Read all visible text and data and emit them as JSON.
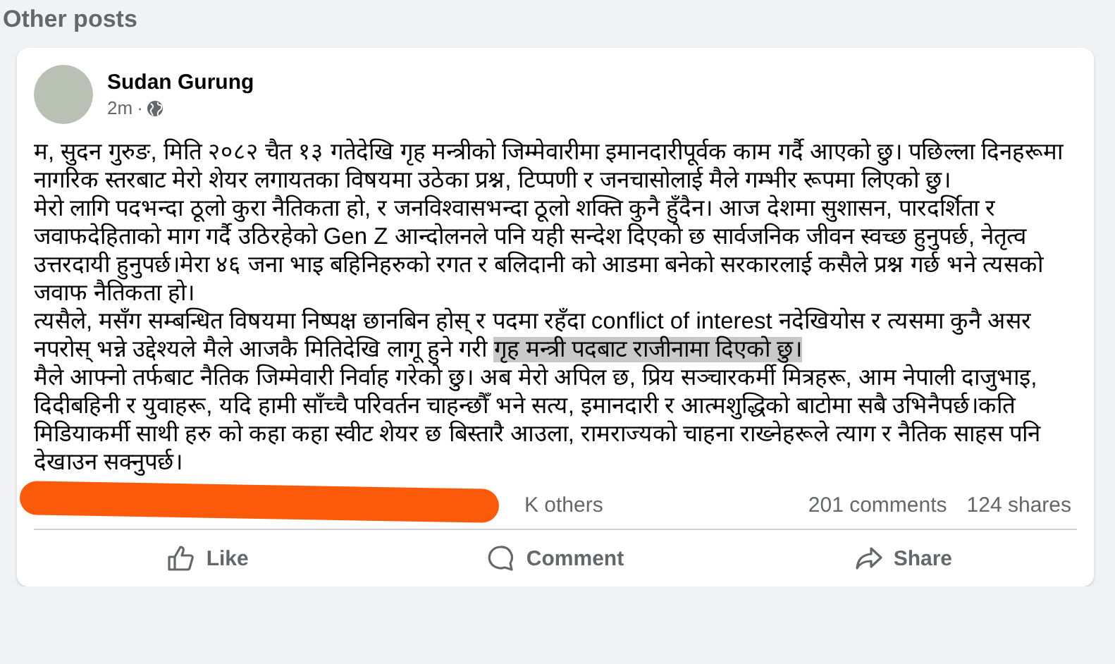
{
  "section_title": "Other posts",
  "post": {
    "author": "Sudan Gurung",
    "time": "2m",
    "separator": "·",
    "paragraphs": [
      {
        "text": "म, सुदन गुरुङ, मिति २०८२ चैत १३ गतेदेखि गृह मन्त्रीको जिम्मेवारीमा इमानदारीपूर्वक काम गर्दै आएको छु। पछिल्ला दिनहरूमा नागरिक स्तरबाट मेरो शेयर लगायतका विषयमा उठेका प्रश्न, टिप्पणी र जनचासोलाई मैले गम्भीर रूपमा लिएको छु।"
      },
      {
        "text": "मेरो लागि पदभन्दा ठूलो कुरा नैतिकता हो, र जनविश्वासभन्दा ठूलो शक्ति कुनै हुँदैन। आज देशमा सुशासन, पारदर्शिता र जवाफदेहिताको माग गर्दै उठिरहेको Gen Z  आन्दोलनले पनि यही सन्देश दिएको छ सार्वजनिक जीवन स्वच्छ हुनुपर्छ, नेतृत्व उत्तरदायी हुनुपर्छ।मेरा ४६ जना भाइ बहिनिहरुको रगत र बलिदानी को आडमा बनेको सरकारलाई कसैले प्रश्न गर्छ भने त्यसको जवाफ नैतिकता हो।"
      },
      {
        "text": "त्यसैले, मसँग सम्बन्धित विषयमा निष्पक्ष छानबिन होस् र पदमा रहँदा conflict of interest नदेखियोस र  त्यसमा कुनै असर नपरोस् भन्ने उद्देश्यले मैले आजकै मितिदेखि लागू हुने गरी ",
        "highlight": "गृह मन्त्री पदबाट राजीनामा दिएको छु।"
      },
      {
        "text": "मैले आफ्नो तर्फबाट नैतिक जिम्मेवारी निर्वाह गरेको छु। अब मेरो अपिल छ, प्रिय सञ्चारकर्मी मित्रहरू, आम नेपाली दाजुभाइ, दिदीबहिनी र युवाहरू, यदि हामी साँच्चै परिवर्तन चाहन्छौँ भने सत्य, इमानदारी र आत्मशुद्धिको बाटोमा सबै उभिनैपर्छ।कति मिडियाकर्मी साथी हरु को कहा कहा स्वीट शेयर छ बिस्तारै आउला, रामराज्यको चाहना राख्नेहरूले त्याग र नैतिक साहस पनि देखाउन सक्नुपर्छ।"
      }
    ],
    "reactions_text": "K others",
    "comments": "201 comments",
    "shares": "124 shares",
    "actions": [
      {
        "kind": "like",
        "label": "Like"
      },
      {
        "kind": "comment",
        "label": "Comment"
      },
      {
        "kind": "share",
        "label": "Share"
      }
    ]
  }
}
